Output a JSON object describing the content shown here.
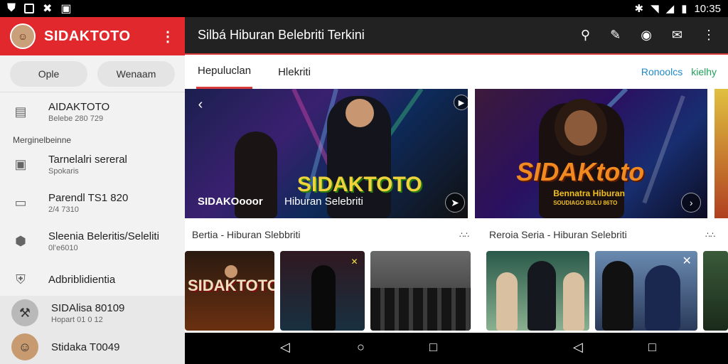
{
  "status_bar": {
    "time": "10:35"
  },
  "drawer": {
    "brand": "SIDAKTOTO",
    "pills": [
      "Ople",
      "Wenaam"
    ],
    "items": [
      {
        "title": "AIDAKTOTO",
        "sub": "Belebe 280 729"
      }
    ],
    "section_label": "Merginelbeinne",
    "items2": [
      {
        "title": "Tarnelalri sereral",
        "sub": "Spokaris"
      },
      {
        "title": "Parendl TS1 820",
        "sub": "2/4 7310"
      },
      {
        "title": "Sleenia Beleritis/Seleliti",
        "sub": "0l’e6010"
      },
      {
        "title": "Adbriblidientia",
        "sub": ""
      }
    ],
    "people": [
      {
        "title": "SIDAlisa 80109",
        "sub": "Hopart 01 0 12"
      },
      {
        "title": "Stidaka T0049",
        "sub": ""
      }
    ]
  },
  "topbar": {
    "title": "Silbá Hiburan Belebriti Terkini"
  },
  "tabs": {
    "active": "Hepuluclan",
    "other": "Hlekriti"
  },
  "tablinks": {
    "a": "Ronoolcs",
    "b": "kielhy"
  },
  "heroes": [
    {
      "logo": "SIDAKTOTO",
      "caption": "SIDAKOooor",
      "caption2": "Hiburan Selebriti"
    },
    {
      "logo": "SIDAKtoto",
      "sub1": "Bennatra Hiburan",
      "sub2": "SOUDIAGO BULU 86TO"
    }
  ],
  "rows": [
    {
      "title": "Bertia - Hiburan Slebbriti",
      "more": "∴∴"
    },
    {
      "title": "Reroia Seria - Hiburan Selebriti",
      "more": "∴∴"
    }
  ],
  "thumb_logo": "SIDAKTOTO"
}
